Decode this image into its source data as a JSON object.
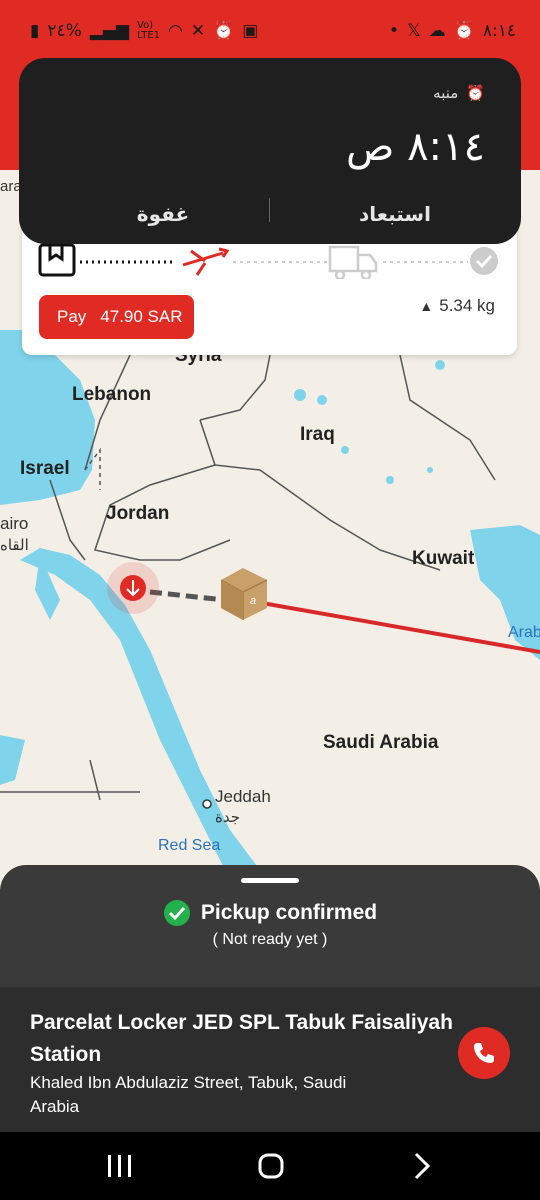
{
  "status_bar": {
    "left_text": "٢٤%",
    "time": "٨:١٤"
  },
  "alarm": {
    "label": "منبه",
    "time": "٨:١٤ ص",
    "dismiss_label": "استبعاد",
    "snooze_label": "غفوة"
  },
  "tracking": {
    "pay_label": "Pay",
    "pay_amount": "47.90 SAR",
    "weight": "5.34 kg",
    "steps": [
      "booking-icon",
      "plane-icon",
      "truck-icon",
      "check-icon"
    ]
  },
  "map": {
    "labels": {
      "syria": "Syria",
      "lebanon": "Lebanon",
      "iraq": "Iraq",
      "israel": "Israel",
      "jordan": "Jordan",
      "kuwait": "Kuwait",
      "saudi": "Saudi Arabia",
      "jeddah": "Jeddah",
      "jeddah_ar": "جدة",
      "cairo": "airo",
      "cairo_ar": "القاه",
      "red_sea": "Red Sea",
      "arab": "Arab",
      "left_top": "ara"
    }
  },
  "sheet": {
    "status": "Pickup confirmed",
    "substatus": "( Not ready yet )",
    "location_name": "Parcelat Locker JED SPL Tabuk Faisaliyah Station",
    "address": "Khaled Ibn Abdulaziz Street, Tabuk, Saudi Arabia"
  },
  "colors": {
    "brand": "#e02b25",
    "sheet": "#3a3a3a",
    "success": "#22b14c"
  }
}
